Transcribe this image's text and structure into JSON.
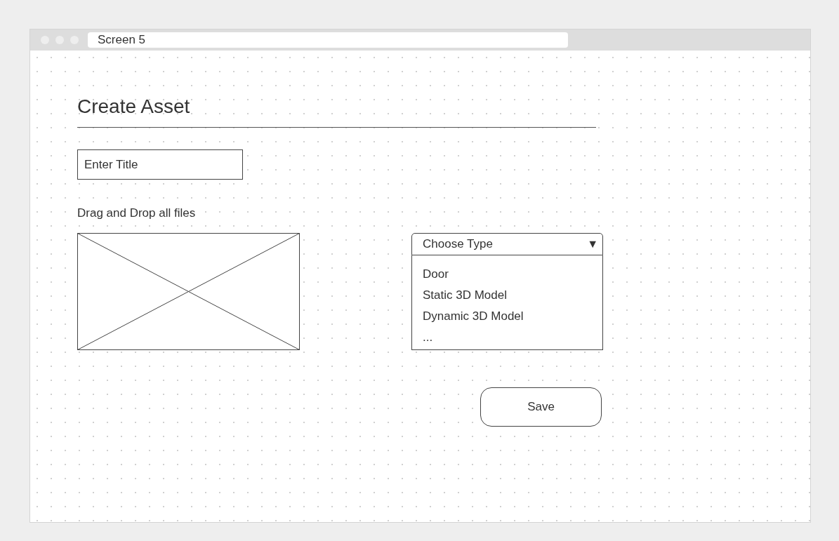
{
  "window": {
    "title": "Screen 5"
  },
  "heading": "Create Asset",
  "title_field": {
    "placeholder": "Enter Title"
  },
  "drop_label": "Drag and Drop all files",
  "type_dropdown": {
    "label": "Choose Type",
    "arrow": "▼",
    "expanded": true,
    "options": [
      "Door",
      "Static 3D Model",
      "Dynamic 3D Model",
      "..."
    ]
  },
  "save_button": "Save"
}
